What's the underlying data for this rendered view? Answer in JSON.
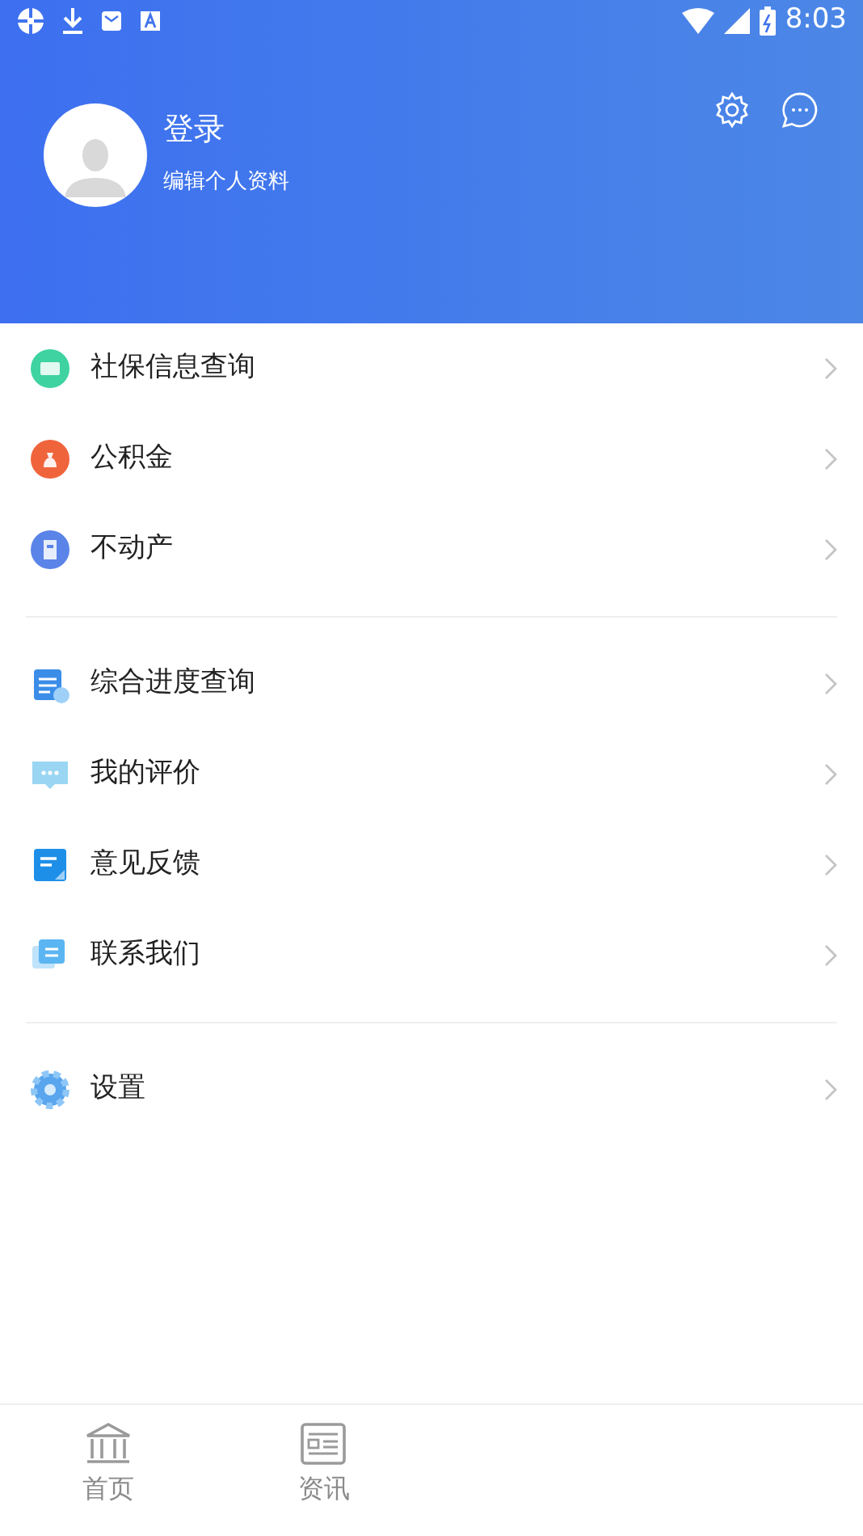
{
  "status_bar": {
    "time": "8:03"
  },
  "profile": {
    "title": "登录",
    "subtitle": "编辑个人资料"
  },
  "menu_groups": [
    {
      "items": [
        {
          "label": "社保信息查询"
        },
        {
          "label": "公积金"
        },
        {
          "label": "不动产"
        }
      ]
    },
    {
      "items": [
        {
          "label": "综合进度查询"
        },
        {
          "label": "我的评价"
        },
        {
          "label": "意见反馈"
        },
        {
          "label": "联系我们"
        }
      ]
    },
    {
      "items": [
        {
          "label": "设置"
        }
      ]
    }
  ],
  "bottom_nav": [
    {
      "label": "首页"
    },
    {
      "label": "资讯"
    }
  ]
}
